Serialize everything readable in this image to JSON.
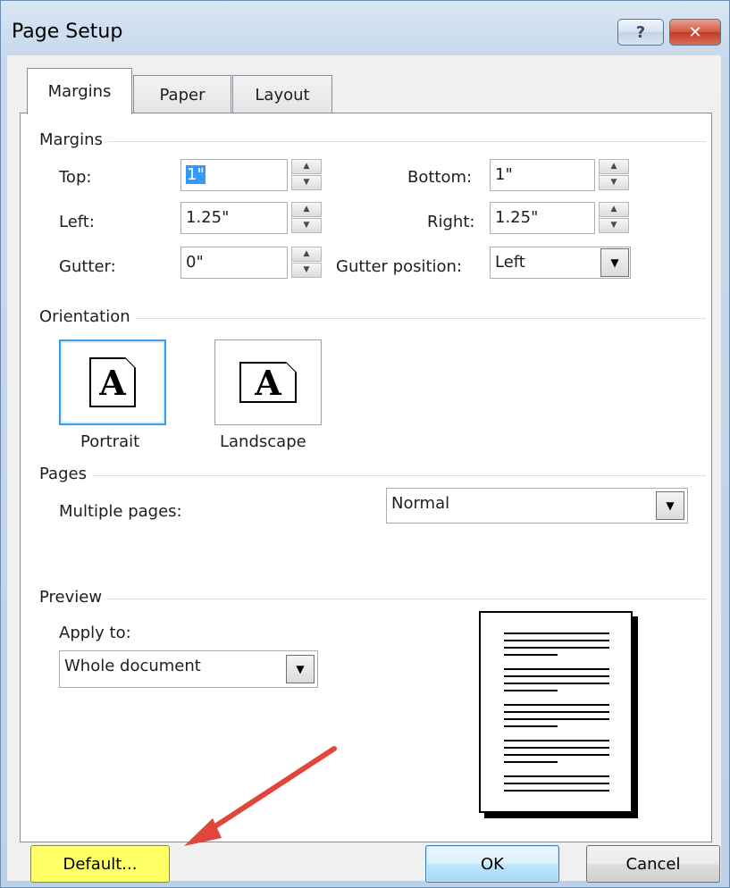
{
  "window": {
    "title": "Page Setup",
    "help_glyph": "?",
    "close_glyph": "✕"
  },
  "tabs": [
    {
      "label": "Margins",
      "active": true
    },
    {
      "label": "Paper",
      "active": false
    },
    {
      "label": "Layout",
      "active": false
    }
  ],
  "margins": {
    "section_label": "Margins",
    "top": {
      "label": "Top:",
      "value": "1\""
    },
    "bottom": {
      "label": "Bottom:",
      "value": "1\""
    },
    "left": {
      "label": "Left:",
      "value": "1.25\""
    },
    "right": {
      "label": "Right:",
      "value": "1.25\""
    },
    "gutter": {
      "label": "Gutter:",
      "value": "0\""
    },
    "gutter_position": {
      "label": "Gutter position:",
      "value": "Left"
    }
  },
  "orientation": {
    "section_label": "Orientation",
    "portrait_label": "Portrait",
    "landscape_label": "Landscape",
    "icon_letter": "A",
    "selected": "Portrait"
  },
  "pages": {
    "section_label": "Pages",
    "multiple_pages_label": "Multiple pages:",
    "multiple_pages_value": "Normal"
  },
  "preview": {
    "section_label": "Preview",
    "apply_to_label": "Apply to:",
    "apply_to_value": "Whole document"
  },
  "buttons": {
    "default": "Default...",
    "ok": "OK",
    "cancel": "Cancel"
  },
  "icons": {
    "spin_up": "▲",
    "spin_down": "▼",
    "dropdown_arrow": "▼"
  },
  "colors": {
    "highlight": "#ffff66",
    "annotation_arrow": "#e0463c",
    "selection": "#3399ff"
  }
}
